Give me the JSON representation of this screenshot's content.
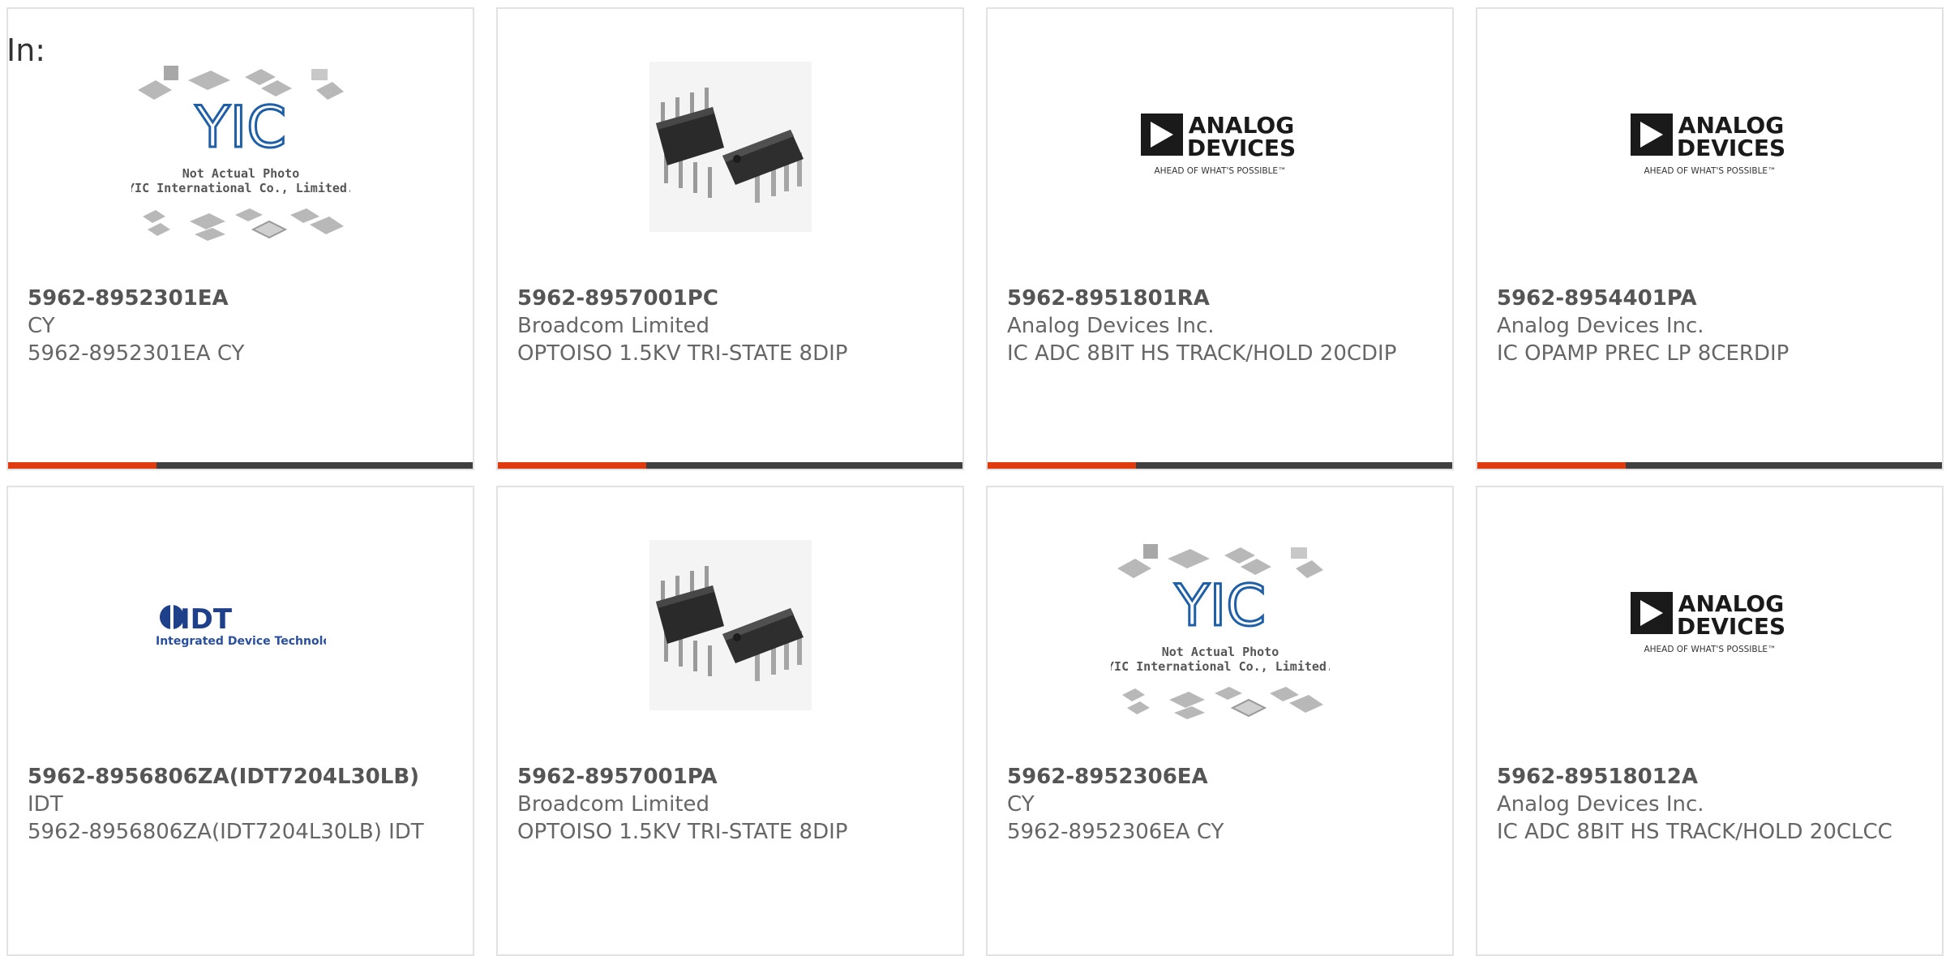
{
  "header": {
    "in_label": "In:"
  },
  "colors": {
    "accent": "#e03a0f",
    "bar": "#3f3f3f",
    "border": "#e2e2e2"
  },
  "products": [
    {
      "part_number": "5962-8952301EA",
      "manufacturer": "CY",
      "description": "5962-8952301EA CY",
      "image": "yic-not-actual-photo",
      "image_text": {
        "brand": "YIC",
        "line1": "Not Actual Photo",
        "line2": "YIC International Co., Limited."
      }
    },
    {
      "part_number": "5962-8957001PC",
      "manufacturer": "Broadcom Limited",
      "description": "OPTOISO 1.5KV TRI-STATE 8DIP",
      "image": "dip8-chip-photo"
    },
    {
      "part_number": "5962-8951801RA",
      "manufacturer": "Analog Devices Inc.",
      "description": "IC ADC 8BIT HS TRACK/HOLD 20CDIP",
      "image": "analog-devices-logo",
      "image_text": {
        "line1": "ANALOG",
        "line2": "DEVICES",
        "tagline": "AHEAD OF WHAT'S POSSIBLE™"
      }
    },
    {
      "part_number": "5962-8954401PA",
      "manufacturer": "Analog Devices Inc.",
      "description": "IC OPAMP PREC LP 8CERDIP",
      "image": "analog-devices-logo",
      "image_text": {
        "line1": "ANALOG",
        "line2": "DEVICES",
        "tagline": "AHEAD OF WHAT'S POSSIBLE™"
      }
    },
    {
      "part_number": "5962-8956806ZA(IDT7204L30LB)",
      "manufacturer": "IDT",
      "description": "5962-8956806ZA(IDT7204L30LB) IDT",
      "image": "idt-logo",
      "image_text": {
        "brand": "IDT",
        "tagline": "Integrated Device Technology"
      }
    },
    {
      "part_number": "5962-8957001PA",
      "manufacturer": "Broadcom Limited",
      "description": "OPTOISO 1.5KV TRI-STATE 8DIP",
      "image": "dip8-chip-photo"
    },
    {
      "part_number": "5962-8952306EA",
      "manufacturer": "CY",
      "description": "5962-8952306EA CY",
      "image": "yic-not-actual-photo",
      "image_text": {
        "brand": "YIC",
        "line1": "Not Actual Photo",
        "line2": "YIC International Co., Limited."
      }
    },
    {
      "part_number": "5962-89518012A",
      "manufacturer": "Analog Devices Inc.",
      "description": "IC ADC 8BIT HS TRACK/HOLD 20CLCC",
      "image": "analog-devices-logo",
      "image_text": {
        "line1": "ANALOG",
        "line2": "DEVICES",
        "tagline": "AHEAD OF WHAT'S POSSIBLE™"
      }
    }
  ]
}
